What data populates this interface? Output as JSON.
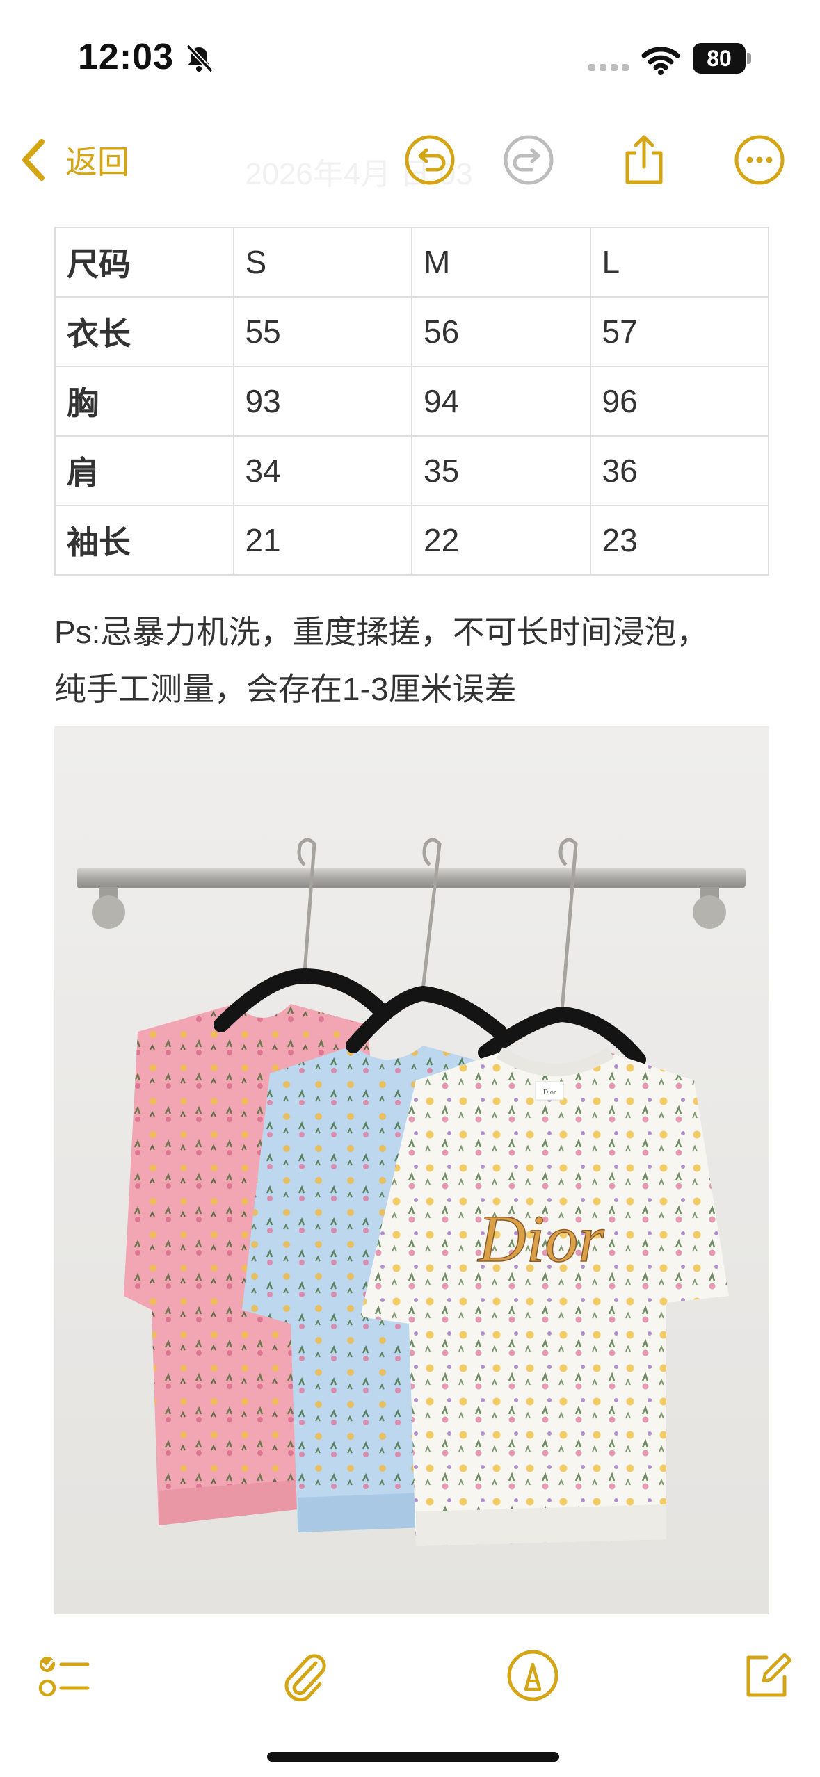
{
  "status_bar": {
    "time": "12:03",
    "battery_level": "80"
  },
  "nav": {
    "back_label": "返回",
    "ghost_title": "2026年4月   日   03"
  },
  "size_table": {
    "rows": [
      [
        "尺码",
        "S",
        "M",
        "L"
      ],
      [
        "衣长",
        "55",
        "56",
        "57"
      ],
      [
        "胸",
        "93",
        "94",
        "96"
      ],
      [
        "肩",
        "34",
        "35",
        "36"
      ],
      [
        "袖长",
        "21",
        "22",
        "23"
      ]
    ]
  },
  "note": {
    "line1": "Ps:忌暴力机洗，重度揉搓，不可长时间浸泡，",
    "line2": "纯手工测量，会存在1-3厘米误差"
  },
  "photo": {
    "brand_logo": "Dior",
    "label_text": "Dior"
  },
  "colors": {
    "accent": "#d4a514",
    "pink_shirt": "#f2a5b2",
    "blue_shirt": "#bcd7ee",
    "white_shirt": "#f7f6f1"
  },
  "icons": {
    "back": "chevron-left-icon",
    "undo": "undo-icon",
    "redo": "redo-icon",
    "share": "share-icon",
    "more": "more-icon",
    "checklist": "checklist-icon",
    "attachment": "paperclip-icon",
    "markup": "markup-pen-icon",
    "compose": "compose-icon"
  }
}
